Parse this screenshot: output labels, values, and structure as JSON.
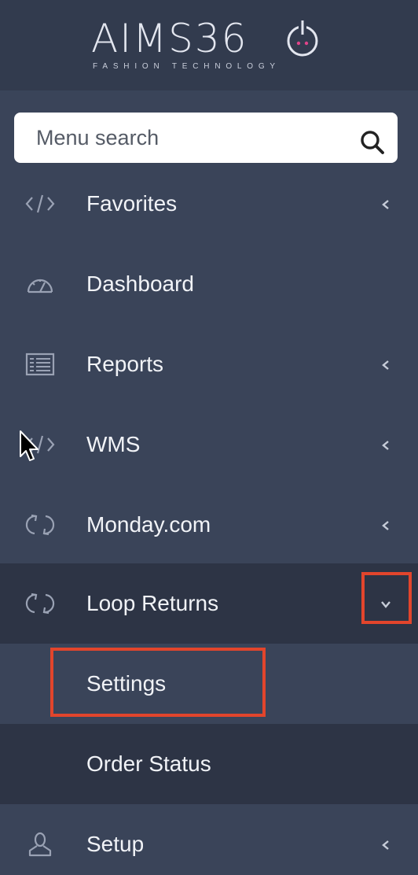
{
  "brand": {
    "name": "AIMS36",
    "tagline": "FASHION TECHNOLOGY"
  },
  "search": {
    "placeholder": "Menu search"
  },
  "menu": [
    {
      "label": "Favorites",
      "icon": "code-icon",
      "has_children": true,
      "expanded": false
    },
    {
      "label": "Dashboard",
      "icon": "dashboard-icon",
      "has_children": false,
      "expanded": false
    },
    {
      "label": "Reports",
      "icon": "report-icon",
      "has_children": true,
      "expanded": false
    },
    {
      "label": "WMS",
      "icon": "code-icon",
      "has_children": true,
      "expanded": false
    },
    {
      "label": "Monday.com",
      "icon": "sync-icon",
      "has_children": true,
      "expanded": false
    },
    {
      "label": "Loop Returns",
      "icon": "sync-icon",
      "has_children": true,
      "expanded": true,
      "children": [
        {
          "label": "Settings"
        },
        {
          "label": "Order Status"
        }
      ]
    },
    {
      "label": "Setup",
      "icon": "user-icon",
      "has_children": true,
      "expanded": false
    }
  ],
  "colors": {
    "sidebar_bg": "#3a4459",
    "header_bg": "#323b4e",
    "active_bg": "#2d3445",
    "highlight": "#e2452c",
    "brand_accent": "#e0448a"
  }
}
